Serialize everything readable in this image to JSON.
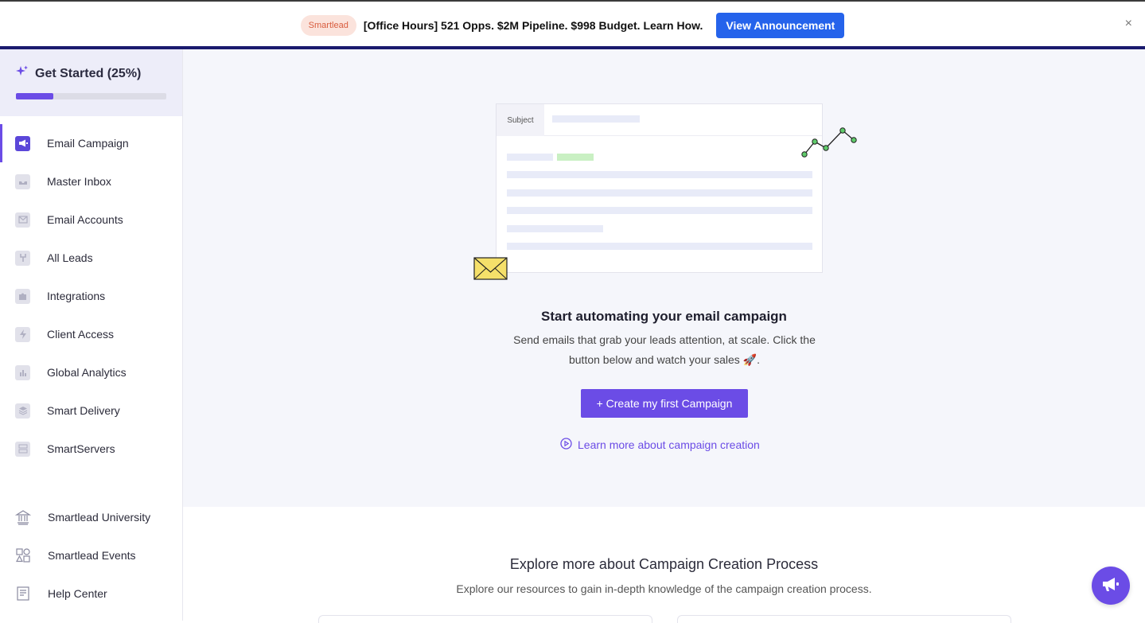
{
  "announcement": {
    "badge": "Smartlead",
    "text": "[Office Hours] 521 Opps. $2M Pipeline. $998 Budget. Learn How.",
    "button": "View Announcement",
    "close": "×"
  },
  "sidebar": {
    "get_started": {
      "title": "Get Started (25%)",
      "progress": 0.25
    },
    "items": [
      {
        "label": "Email Campaign",
        "icon": "megaphone-icon",
        "active": true
      },
      {
        "label": "Master Inbox",
        "icon": "inbox-icon"
      },
      {
        "label": "Email Accounts",
        "icon": "mail-icon"
      },
      {
        "label": "All Leads",
        "icon": "leads-icon"
      },
      {
        "label": "Integrations",
        "icon": "puzzle-icon"
      },
      {
        "label": "Client Access",
        "icon": "bolt-icon"
      },
      {
        "label": "Global Analytics",
        "icon": "bar-chart-icon"
      },
      {
        "label": "Smart Delivery",
        "icon": "layers-icon"
      },
      {
        "label": "SmartServers",
        "icon": "server-icon"
      }
    ],
    "bottom_items": [
      {
        "label": "Smartlead University",
        "icon": "university-icon"
      },
      {
        "label": "Smartlead Events",
        "icon": "events-icon"
      },
      {
        "label": "Help Center",
        "icon": "help-doc-icon"
      }
    ]
  },
  "hero": {
    "illustration_subject": "Subject",
    "title": "Start automating your email campaign",
    "description": "Send emails that grab your leads attention, at scale. Click the button below and watch your sales 🚀.",
    "create_button": "+ Create my first Campaign",
    "learn_link": "Learn more about campaign creation"
  },
  "explore": {
    "title": "Explore more about Campaign Creation Process",
    "subtitle": "Explore our resources to gain in-depth knowledge of the campaign creation process."
  },
  "colors": {
    "accent": "#6b4ce6",
    "announce_button": "#2563eb"
  }
}
